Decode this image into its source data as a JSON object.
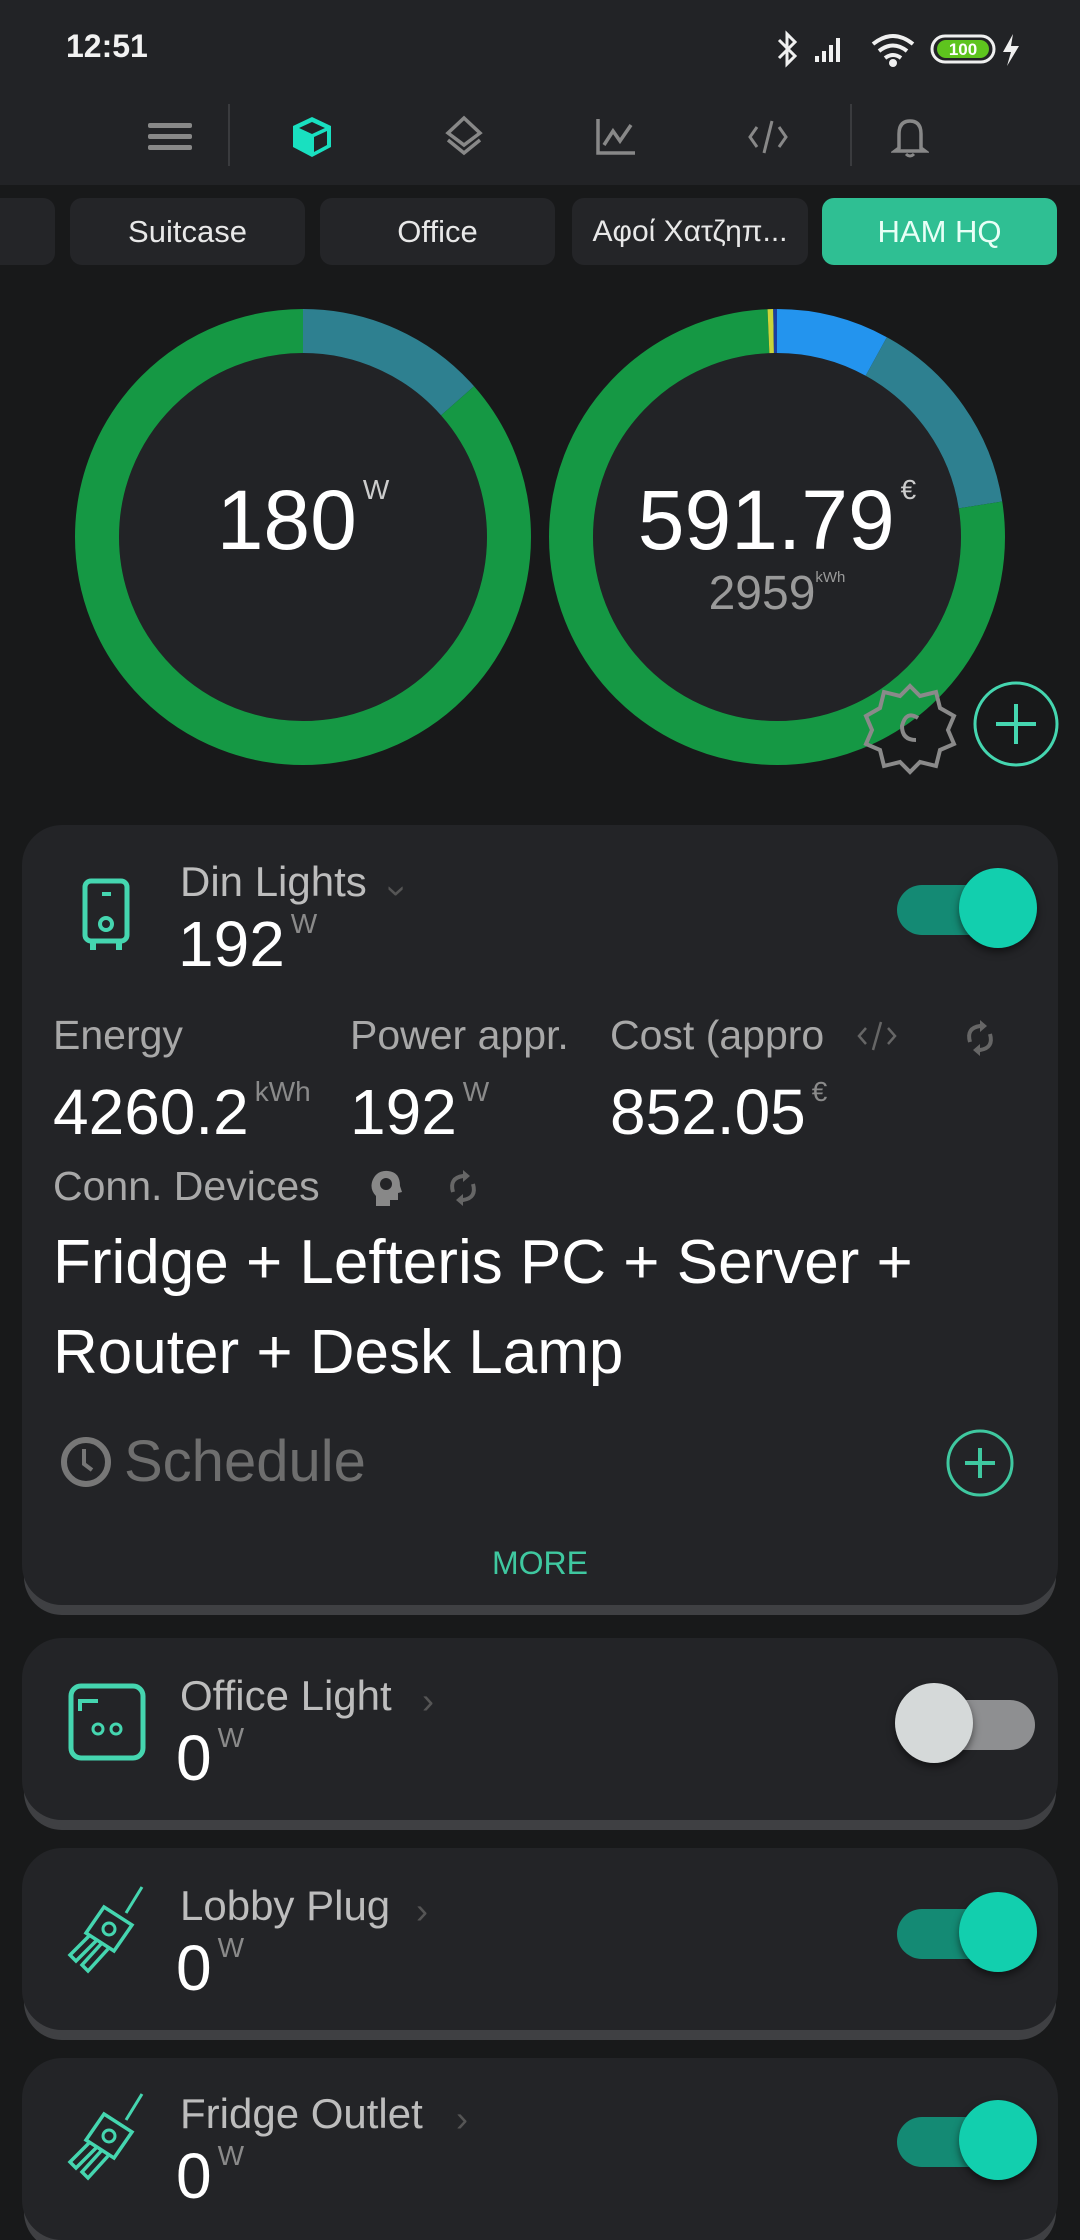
{
  "status_bar": {
    "time": "12:51",
    "battery": "100",
    "icons": [
      "bluetooth-icon",
      "signal-icon",
      "wifi-icon",
      "battery-icon",
      "charging-icon"
    ]
  },
  "nav": {
    "items": [
      "menu-icon",
      "devices-cube-icon",
      "layers-icon",
      "chart-icon",
      "code-icon",
      "bell-icon"
    ],
    "active": "devices-cube-icon",
    "accent": "#19e0c0"
  },
  "tabs": [
    {
      "label": ""
    },
    {
      "label": "Suitcase"
    },
    {
      "label": "Office"
    },
    {
      "label": "Αφοί Χατζηπ..."
    },
    {
      "label": "HAM HQ",
      "active": true
    }
  ],
  "summary": {
    "power_value": "180",
    "power_unit": "W",
    "cost_value": "591.79",
    "cost_unit": "€",
    "energy_value": "2959",
    "energy_unit": "kWh"
  },
  "chart_data": [
    {
      "type": "pie",
      "variant": "donut",
      "segments": [
        {
          "percent": 13.5,
          "color": "#2e8090"
        },
        {
          "percent": 86.5,
          "color": "#159844"
        }
      ]
    },
    {
      "type": "pie",
      "variant": "donut",
      "segments": [
        {
          "percent": 8.0,
          "color": "#2394ee"
        },
        {
          "percent": 14.5,
          "color": "#2e8090"
        },
        {
          "percent": 76.8,
          "color": "#159844"
        },
        {
          "percent": 0.4,
          "color": "#c9d43a"
        },
        {
          "percent": 0.3,
          "color": "#1b3fa0"
        }
      ]
    }
  ],
  "devices": [
    {
      "name": "Din Lights",
      "power": "192",
      "unit": "W",
      "on": true,
      "expanded": true,
      "icon": "water-heater-icon",
      "details": {
        "energy_label": "Energy",
        "energy_value": "4260.2",
        "energy_unit": "kWh",
        "power_label": "Power appr.",
        "power_value": "192",
        "power_unit": "W",
        "cost_label": "Cost (appro",
        "cost_value": "852.05",
        "cost_unit": "€",
        "conn_label": "Conn. Devices",
        "connected": "Fridge + Lefteris PC + Server + Router + Desk Lamp",
        "schedule_label": "Schedule",
        "more_label": "MORE"
      }
    },
    {
      "name": "Office Light",
      "power": "0",
      "unit": "W",
      "on": false,
      "icon": "wall-switch-icon"
    },
    {
      "name": "Lobby Plug",
      "power": "0",
      "unit": "W",
      "on": true,
      "icon": "plug-icon"
    },
    {
      "name": "Fridge Outlet",
      "power": "0",
      "unit": "W",
      "on": true,
      "icon": "plug-icon"
    }
  ]
}
